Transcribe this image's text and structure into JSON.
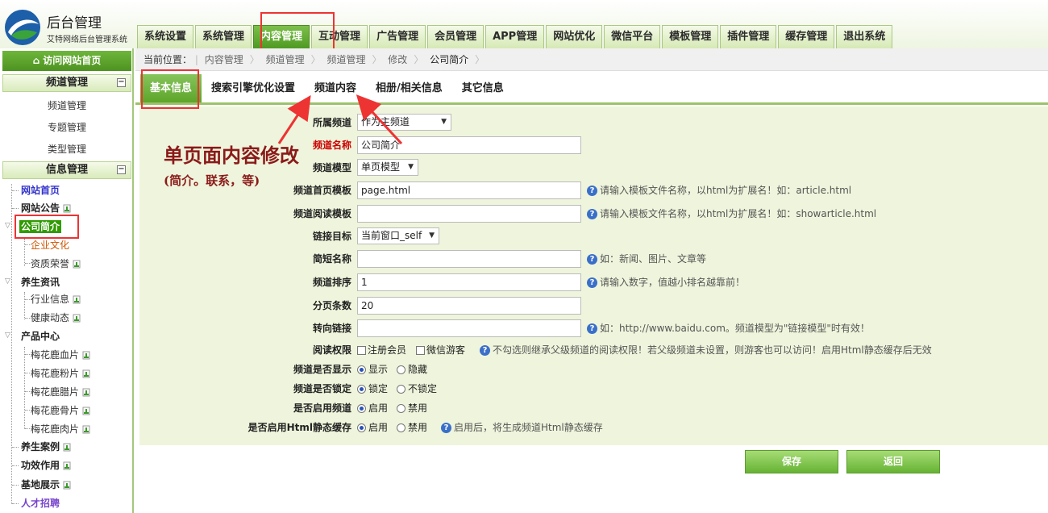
{
  "header": {
    "title": "后台管理",
    "subtitle": "艾特网络后台管理系统",
    "nav": [
      "系统设置",
      "系统管理",
      "内容管理",
      "互动管理",
      "广告管理",
      "会员管理",
      "APP管理",
      "网站优化",
      "微信平台",
      "模板管理",
      "插件管理",
      "缓存管理",
      "退出系统"
    ],
    "active_nav": "内容管理"
  },
  "sidebar": {
    "visit_label": "访问网站首页",
    "channel_group": "频道管理",
    "channel_items": [
      "频道管理",
      "专题管理",
      "类型管理"
    ],
    "info_group": "信息管理",
    "tree": {
      "home": "网站首页",
      "notice": "网站公告",
      "company": "公司简介",
      "culture": "企业文化",
      "honor": "资质荣誉",
      "health_news": "养生资讯",
      "industry": "行业信息",
      "health_dynamics": "健康动态",
      "products": "产品中心",
      "p1": "梅花鹿血片",
      "p2": "梅花鹿粉片",
      "p3": "梅花鹿腊片",
      "p4": "梅花鹿骨片",
      "p5": "梅花鹿肉片",
      "cases": "养生案例",
      "effects": "功效作用",
      "base": "基地展示",
      "jobs": "人才招聘"
    }
  },
  "breadcrumb": {
    "label": "当前位置：",
    "items": [
      "内容管理",
      "频道管理",
      "频道管理",
      "修改",
      "公司简介"
    ]
  },
  "tabs": [
    "基本信息",
    "搜索引擎优化设置",
    "频道内容",
    "相册/相关信息",
    "其它信息"
  ],
  "annotation": {
    "title": "单页面内容修改",
    "subtitle": "(简介。联系，等)"
  },
  "form": {
    "parent_label": "所属频道",
    "parent_value": "作为主频道",
    "name_label": "频道名称",
    "name_value": "公司简介",
    "model_label": "频道模型",
    "model_value": "单页模型",
    "index_tpl_label": "频道首页模板",
    "index_tpl_value": "page.html",
    "index_tpl_hint": "请输入模板文件名称，以html为扩展名！如：article.html",
    "read_tpl_label": "频道阅读模板",
    "read_tpl_value": "",
    "read_tpl_hint": "请输入模板文件名称，以html为扩展名！如：showarticle.html",
    "target_label": "链接目标",
    "target_value": "当前窗口_self",
    "short_label": "简短名称",
    "short_value": "",
    "short_hint": "如：新闻、图片、文章等",
    "order_label": "频道排序",
    "order_value": "1",
    "order_hint": "请输入数字，值越小排名越靠前！",
    "pagesize_label": "分页条数",
    "pagesize_value": "20",
    "redirect_label": "转向链接",
    "redirect_value": "",
    "redirect_hint": "如：http://www.baidu.com。频道模型为\"链接模型\"时有效！",
    "perm_label": "阅读权限",
    "perm_opt1": "注册会员",
    "perm_opt2": "微信游客",
    "perm_hint": "不勾选则继承父级频道的阅读权限！若父级频道未设置，则游客也可以访问！启用Html静态缓存后无效",
    "show_label": "频道是否显示",
    "show_opt1": "显示",
    "show_opt2": "隐藏",
    "lock_label": "频道是否锁定",
    "lock_opt1": "锁定",
    "lock_opt2": "不锁定",
    "enable_label": "是否启用频道",
    "enable_opt1": "启用",
    "enable_opt2": "禁用",
    "cache_label": "是否启用Html静态缓存",
    "cache_opt1": "启用",
    "cache_opt2": "禁用",
    "cache_hint": "启用后，将生成频道Html静态缓存"
  },
  "buttons": {
    "save": "保存",
    "back": "返回"
  },
  "colors": {
    "accent_green": "#4e9a22",
    "form_bg": "#eef5dc",
    "annotation_red": "#e33333"
  }
}
